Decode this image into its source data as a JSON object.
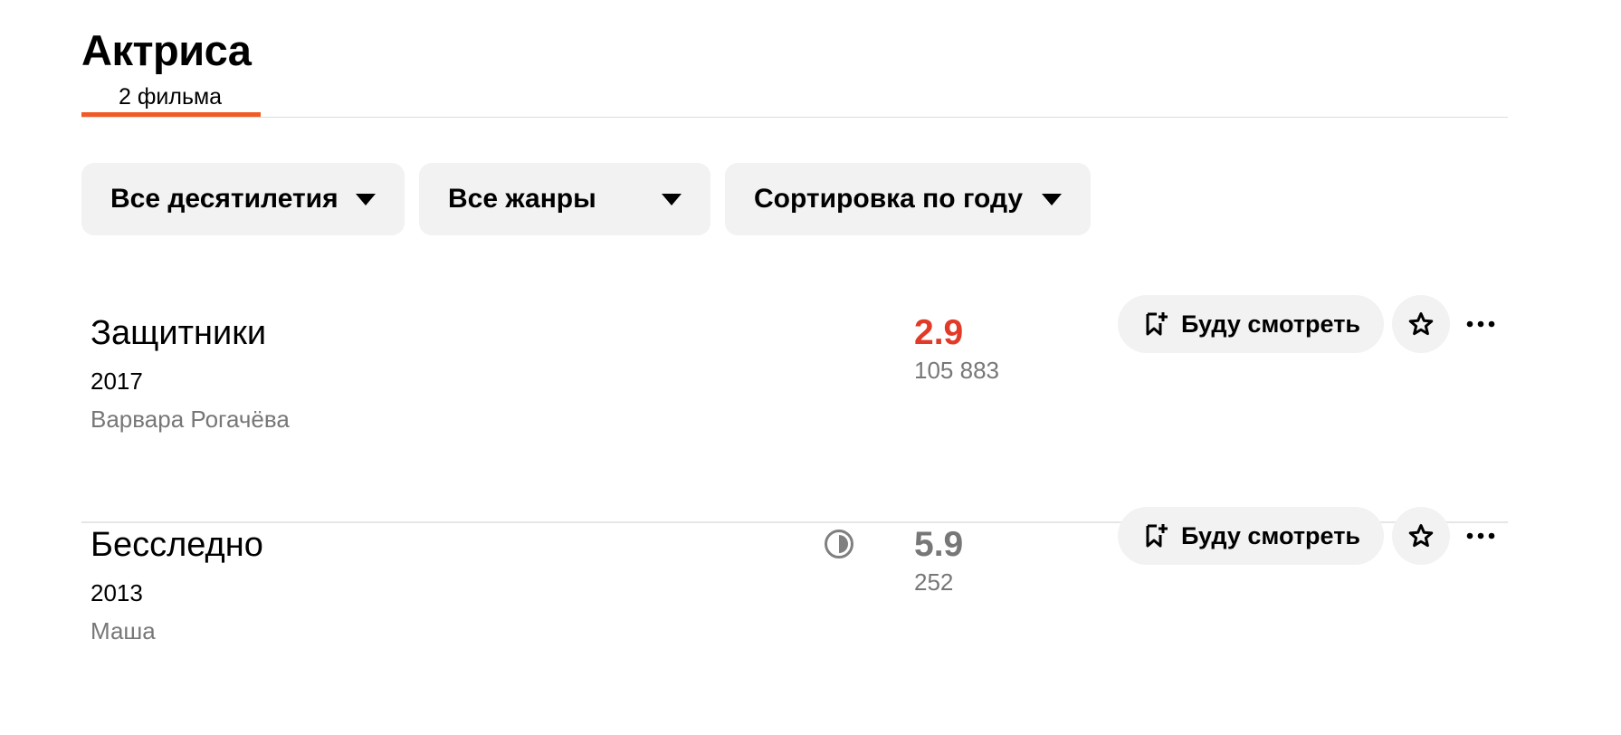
{
  "section": {
    "title": "Актриса",
    "tab_label": "2 фильма",
    "accent_color": "#f15a24"
  },
  "filters": [
    {
      "label": "Все десятилетия",
      "icon": "caret-down-icon"
    },
    {
      "label": "Все жанры",
      "icon": "caret-down-icon"
    },
    {
      "label": "Сортировка по году",
      "icon": "caret-down-icon"
    }
  ],
  "films": [
    {
      "title": "Защитники",
      "year": "2017",
      "role": "Варвара Рогачёва",
      "rating": "2.9",
      "rating_color": "#e13a27",
      "votes": "105 883",
      "watch_label": "Буду смотреть",
      "status_icon": null
    },
    {
      "title": "Бесследно",
      "year": "2013",
      "role": "Маша",
      "rating": "5.9",
      "rating_color": "#777777",
      "votes": "252",
      "watch_label": "Буду смотреть",
      "status_icon": "half-circle-icon"
    }
  ]
}
